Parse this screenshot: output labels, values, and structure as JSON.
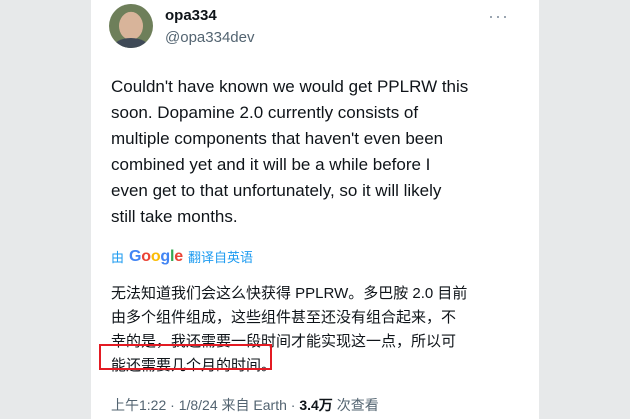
{
  "user": {
    "display_name": "opa334",
    "handle": "@opa334dev"
  },
  "tweet": {
    "lines": [
      "Couldn't have known we would get PPLRW this",
      "soon. Dopamine 2.0 currently consists of",
      "multiple components that haven't even been",
      "combined yet and it will be a while before I",
      "even get to that unfortunately, so it will likely",
      "still take months."
    ]
  },
  "translation": {
    "by": "由",
    "google": [
      "G",
      "o",
      "o",
      "g",
      "l",
      "e"
    ],
    "google_colors": [
      "#4285F4",
      "#EA4335",
      "#FBBC05",
      "#4285F4",
      "#34A853",
      "#EA4335"
    ],
    "label": "翻译自英语",
    "lines": [
      "无法知道我们会这么快获得 PPLRW。多巴胺 2.0 目前",
      "由多个组件组成，这些组件甚至还没有组合起来，不",
      "幸的是，我还需要一段时间才能实现这一点，所以可",
      "能还需要几个月的时间。"
    ]
  },
  "meta": {
    "time": "上午1:22",
    "separator": " · ",
    "date": "1/8/24",
    "source": " 来自 Earth",
    "views": "3.4万",
    "views_label": " 次查看"
  },
  "colors": {
    "link": "#1d9bf0",
    "highlight": "#e31b23",
    "side_background": "#e7e9ea"
  }
}
